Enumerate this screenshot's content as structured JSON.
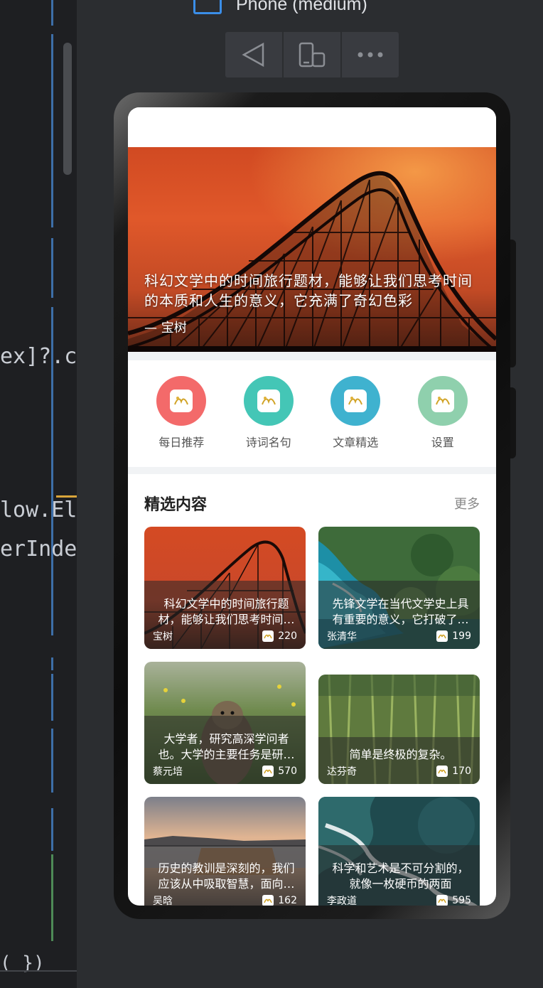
{
  "ide": {
    "code_lines": [
      {
        "text": "ex]?.c"
      },
      {
        "text": "low.El"
      },
      {
        "text": "erInde"
      },
      {
        "text": "( })"
      }
    ]
  },
  "previewer": {
    "device_title": "Phone (medium)",
    "toolbar": [
      {
        "icon": "back-triangle-icon"
      },
      {
        "icon": "rotate-device-icon"
      },
      {
        "icon": "more-dots-icon"
      }
    ]
  },
  "app": {
    "hero": {
      "quote": "科幻文学中的时间旅行题材，能够让我们思考时间的本质和人生的意义，它充满了奇幻色彩",
      "author": "— 宝树"
    },
    "menu": [
      {
        "label": "每日推荐",
        "color": "#f36a6a"
      },
      {
        "label": "诗词名句",
        "color": "#44c6b6"
      },
      {
        "label": "文章精选",
        "color": "#3fb2cf"
      },
      {
        "label": "设置",
        "color": "#8fd0ad"
      }
    ],
    "section": {
      "title": "精选内容",
      "more": "更多"
    },
    "cards": [
      {
        "quote": "科幻文学中的时间旅行题材，能够让我们思考时间的本质",
        "author": "宝树",
        "likes": "220",
        "theme": "sunset"
      },
      {
        "quote": "先锋文学在当代文学史上具有重要的意义，它打破了传统",
        "author": "张清华",
        "likes": "199",
        "theme": "coast"
      },
      {
        "quote": "大学者，研究高深学问者也。大学的主要任务是研究学问",
        "author": "蔡元培",
        "likes": "570",
        "theme": "meadow"
      },
      {
        "quote": "简单是终极的复杂。",
        "author": "达芬奇",
        "likes": "170",
        "theme": "forest"
      },
      {
        "quote": "历史的教训是深刻的，我们应该从中吸取智慧，面向未来",
        "author": "吴晗",
        "likes": "162",
        "theme": "falls"
      },
      {
        "quote": "科学和艺术是不可分割的，就像一枚硬币的两面",
        "author": "李政道",
        "likes": "595",
        "theme": "ice"
      }
    ]
  }
}
